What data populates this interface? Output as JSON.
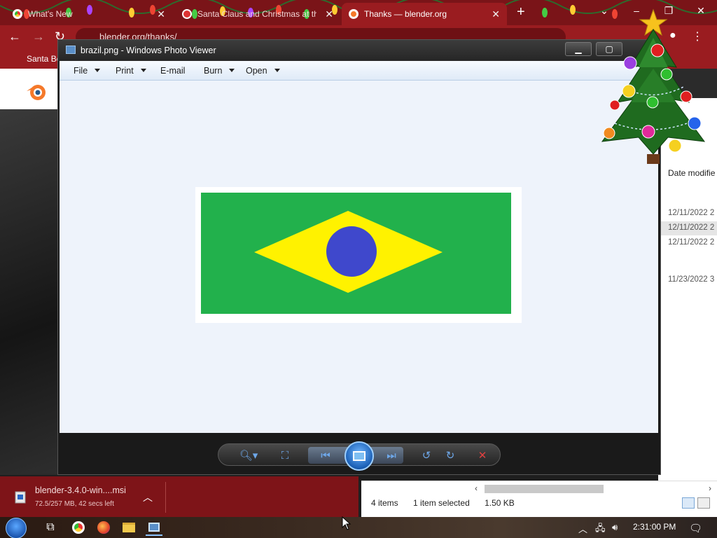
{
  "browser": {
    "tabs": [
      {
        "title": "What's New",
        "favicon": "chrome-icon"
      },
      {
        "title": "Santa Claus and Christmas at the...",
        "favicon": "santa-icon"
      },
      {
        "title": "Thanks — blender.org",
        "favicon": "blender-icon",
        "active": true
      }
    ],
    "url": "blender.org/thanks/",
    "bookmark_label": "Santa Bo",
    "colors": {
      "frame": "#7a1418",
      "toolbar": "#9a1c20"
    }
  },
  "photo_viewer": {
    "title": "brazil.png - Windows Photo Viewer",
    "menu": [
      {
        "label": "File",
        "dropdown": true
      },
      {
        "label": "Print",
        "dropdown": true
      },
      {
        "label": "E-mail",
        "dropdown": false
      },
      {
        "label": "Burn",
        "dropdown": true
      },
      {
        "label": "Open",
        "dropdown": true
      }
    ],
    "controls": [
      "zoom-icon",
      "actual-size-icon",
      "previous-icon",
      "slideshow-icon",
      "next-icon",
      "rotate-left-icon",
      "rotate-right-icon",
      "delete-icon"
    ],
    "flag_colors": {
      "green": "#22b14c",
      "yellow": "#fff200",
      "blue": "#3f48cc"
    }
  },
  "explorer": {
    "column_header": "Date modifie",
    "rows": [
      "12/11/2022 2",
      "12/11/2022 2",
      "12/11/2022 2",
      "11/23/2022 3"
    ],
    "status": {
      "items": "4 items",
      "selected": "1 item selected",
      "size": "1.50 KB"
    }
  },
  "download": {
    "filename": "blender-3.4.0-win....msi",
    "progress": "72.5/257 MB, 42 secs left"
  },
  "taskbar": {
    "clock": "2:31:00 PM",
    "apps": [
      "start-icon",
      "task-view-icon",
      "chrome-icon",
      "firefox-icon",
      "file-explorer-icon",
      "photo-viewer-icon"
    ]
  }
}
